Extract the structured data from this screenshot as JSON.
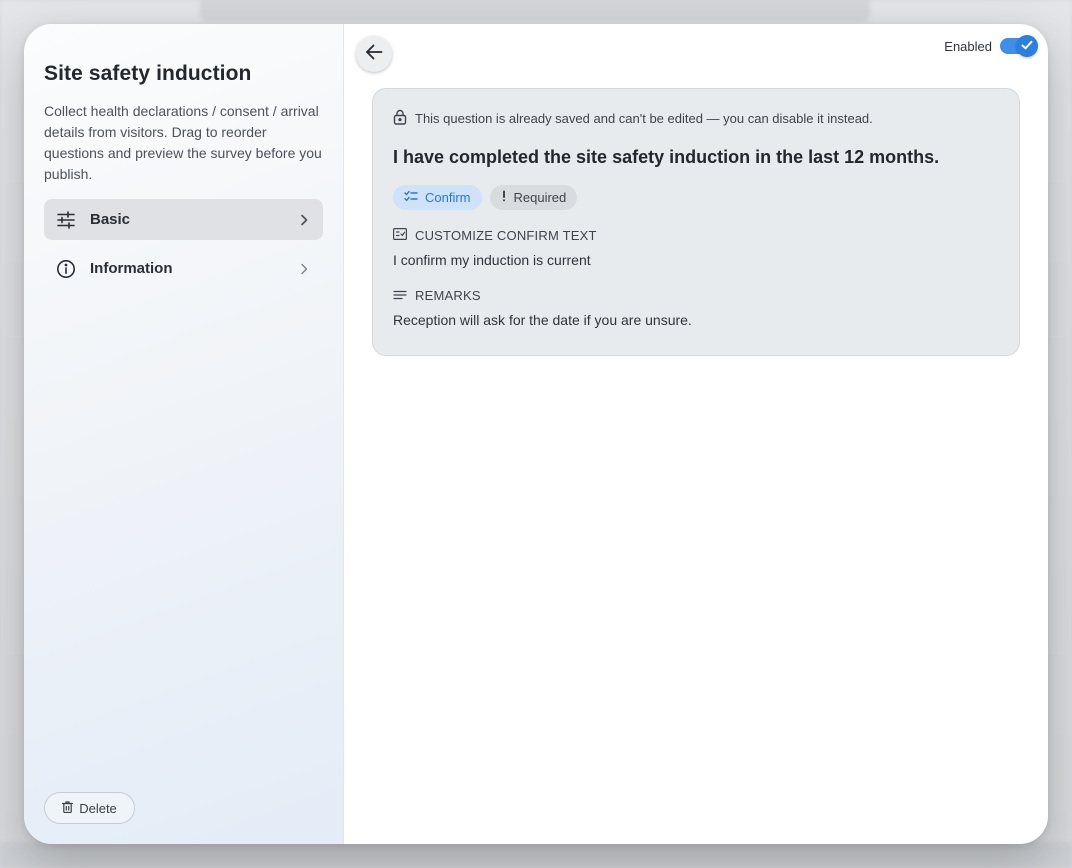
{
  "sidebar": {
    "title": "Site safety induction",
    "description": "Collect health declarations / consent / arrival details from visitors. Drag to reorder questions and preview the survey before you publish.",
    "items": [
      {
        "label": "Basic",
        "icon": "sliders-icon",
        "active": true
      },
      {
        "label": "Information",
        "icon": "info-icon",
        "active": false
      }
    ],
    "delete_label": "Delete"
  },
  "header": {
    "enabled_label": "Enabled",
    "enabled": true
  },
  "question": {
    "lock_notice": "This question is already saved and can't be edited — you can disable it instead.",
    "text": "I have completed the site safety induction in the last 12 months.",
    "chips": {
      "confirm": "Confirm",
      "required": "Required"
    },
    "confirm_text_heading": "CUSTOMIZE CONFIRM TEXT",
    "confirm_text_value": "I confirm my induction is current",
    "remarks_heading": "REMARKS",
    "remarks_value": "Reception will ask for the date if you are unsure."
  },
  "colors": {
    "accent": "#2b7fe0",
    "chip_confirm_bg": "#cfe2f8",
    "card_bg": "#e8ebee"
  }
}
